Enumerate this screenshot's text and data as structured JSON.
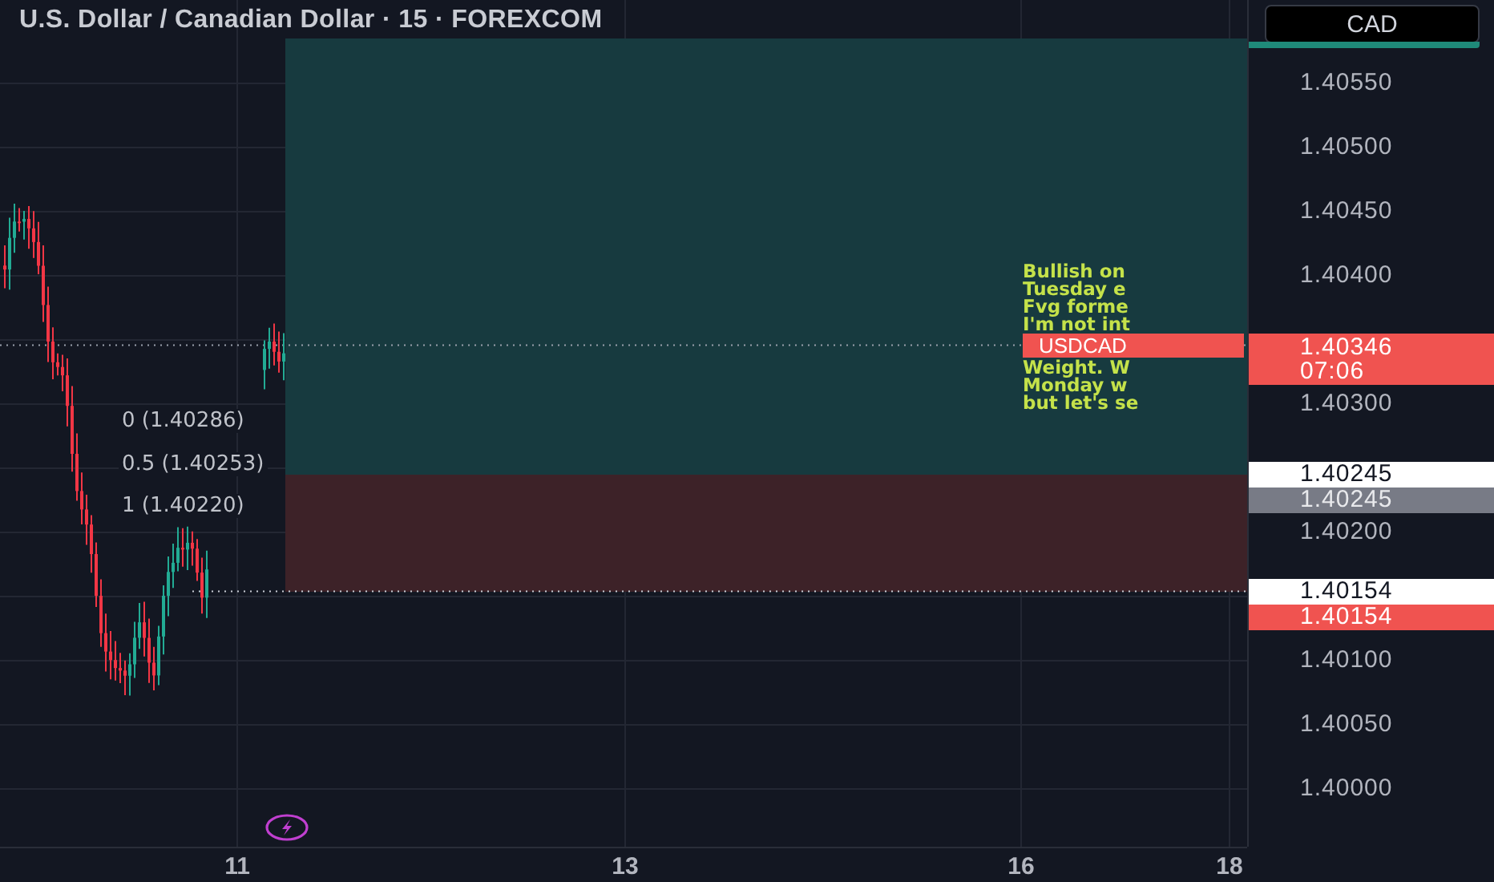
{
  "header": {
    "title": "U.S. Dollar / Canadian Dollar · 15 · FOREXCOM",
    "currency_button": "CAD"
  },
  "chart": {
    "fib_labels": [
      "0 (1.40286)",
      "0.5 (1.40253)",
      "1 (1.40220)"
    ],
    "symbol_label": "USDCAD",
    "note_lines": [
      "Bullish on",
      "Tuesday e",
      "Fvg forme",
      "I'm not int",
      "Weight. W",
      "Monday w",
      "but let's se"
    ]
  },
  "price_scale": {
    "ticks": [
      "1.40550",
      "1.40500",
      "1.40450",
      "1.40400",
      "1.40300",
      "1.40200",
      "1.40100",
      "1.40050",
      "1.40000"
    ],
    "labels": [
      {
        "kind": "current",
        "price": "1.40346",
        "countdown": "07:06"
      },
      {
        "kind": "white",
        "price": "1.40245"
      },
      {
        "kind": "gray",
        "price": "1.40245"
      },
      {
        "kind": "white",
        "price": "1.40154"
      },
      {
        "kind": "red",
        "price": "1.40154"
      }
    ]
  },
  "time_scale": {
    "labels": [
      "11",
      "13",
      "16",
      "18"
    ]
  }
}
